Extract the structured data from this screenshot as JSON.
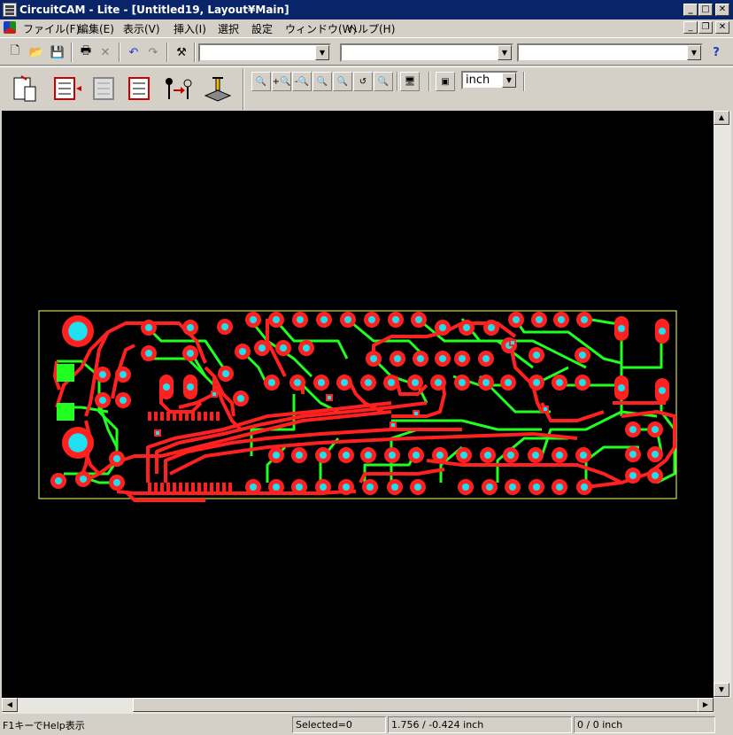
{
  "window": {
    "title": "CircuitCAM - Lite - [Untitled19, Layout¥Main]"
  },
  "menu": {
    "items": [
      "ファイル(F)",
      "編集(E)",
      "表示(V)",
      "挿入(I)",
      "選択",
      "設定",
      "ウィンドウ(W)",
      "ヘルプ(H)"
    ]
  },
  "toolbar": {
    "combo1": "",
    "combo2": "",
    "combo3": "",
    "unit": "inch"
  },
  "pcb": {
    "bg": "#000000",
    "outline": "#ffff66",
    "top_trace": "#ff2020",
    "bottom_trace": "#20ff20",
    "pad_fill": "#20e0f0"
  },
  "status": {
    "help": "F1キーでHelp表示",
    "selected": "Selected=0",
    "coords": "1.756 / -0.424 inch",
    "delta": "0 / 0 inch"
  }
}
